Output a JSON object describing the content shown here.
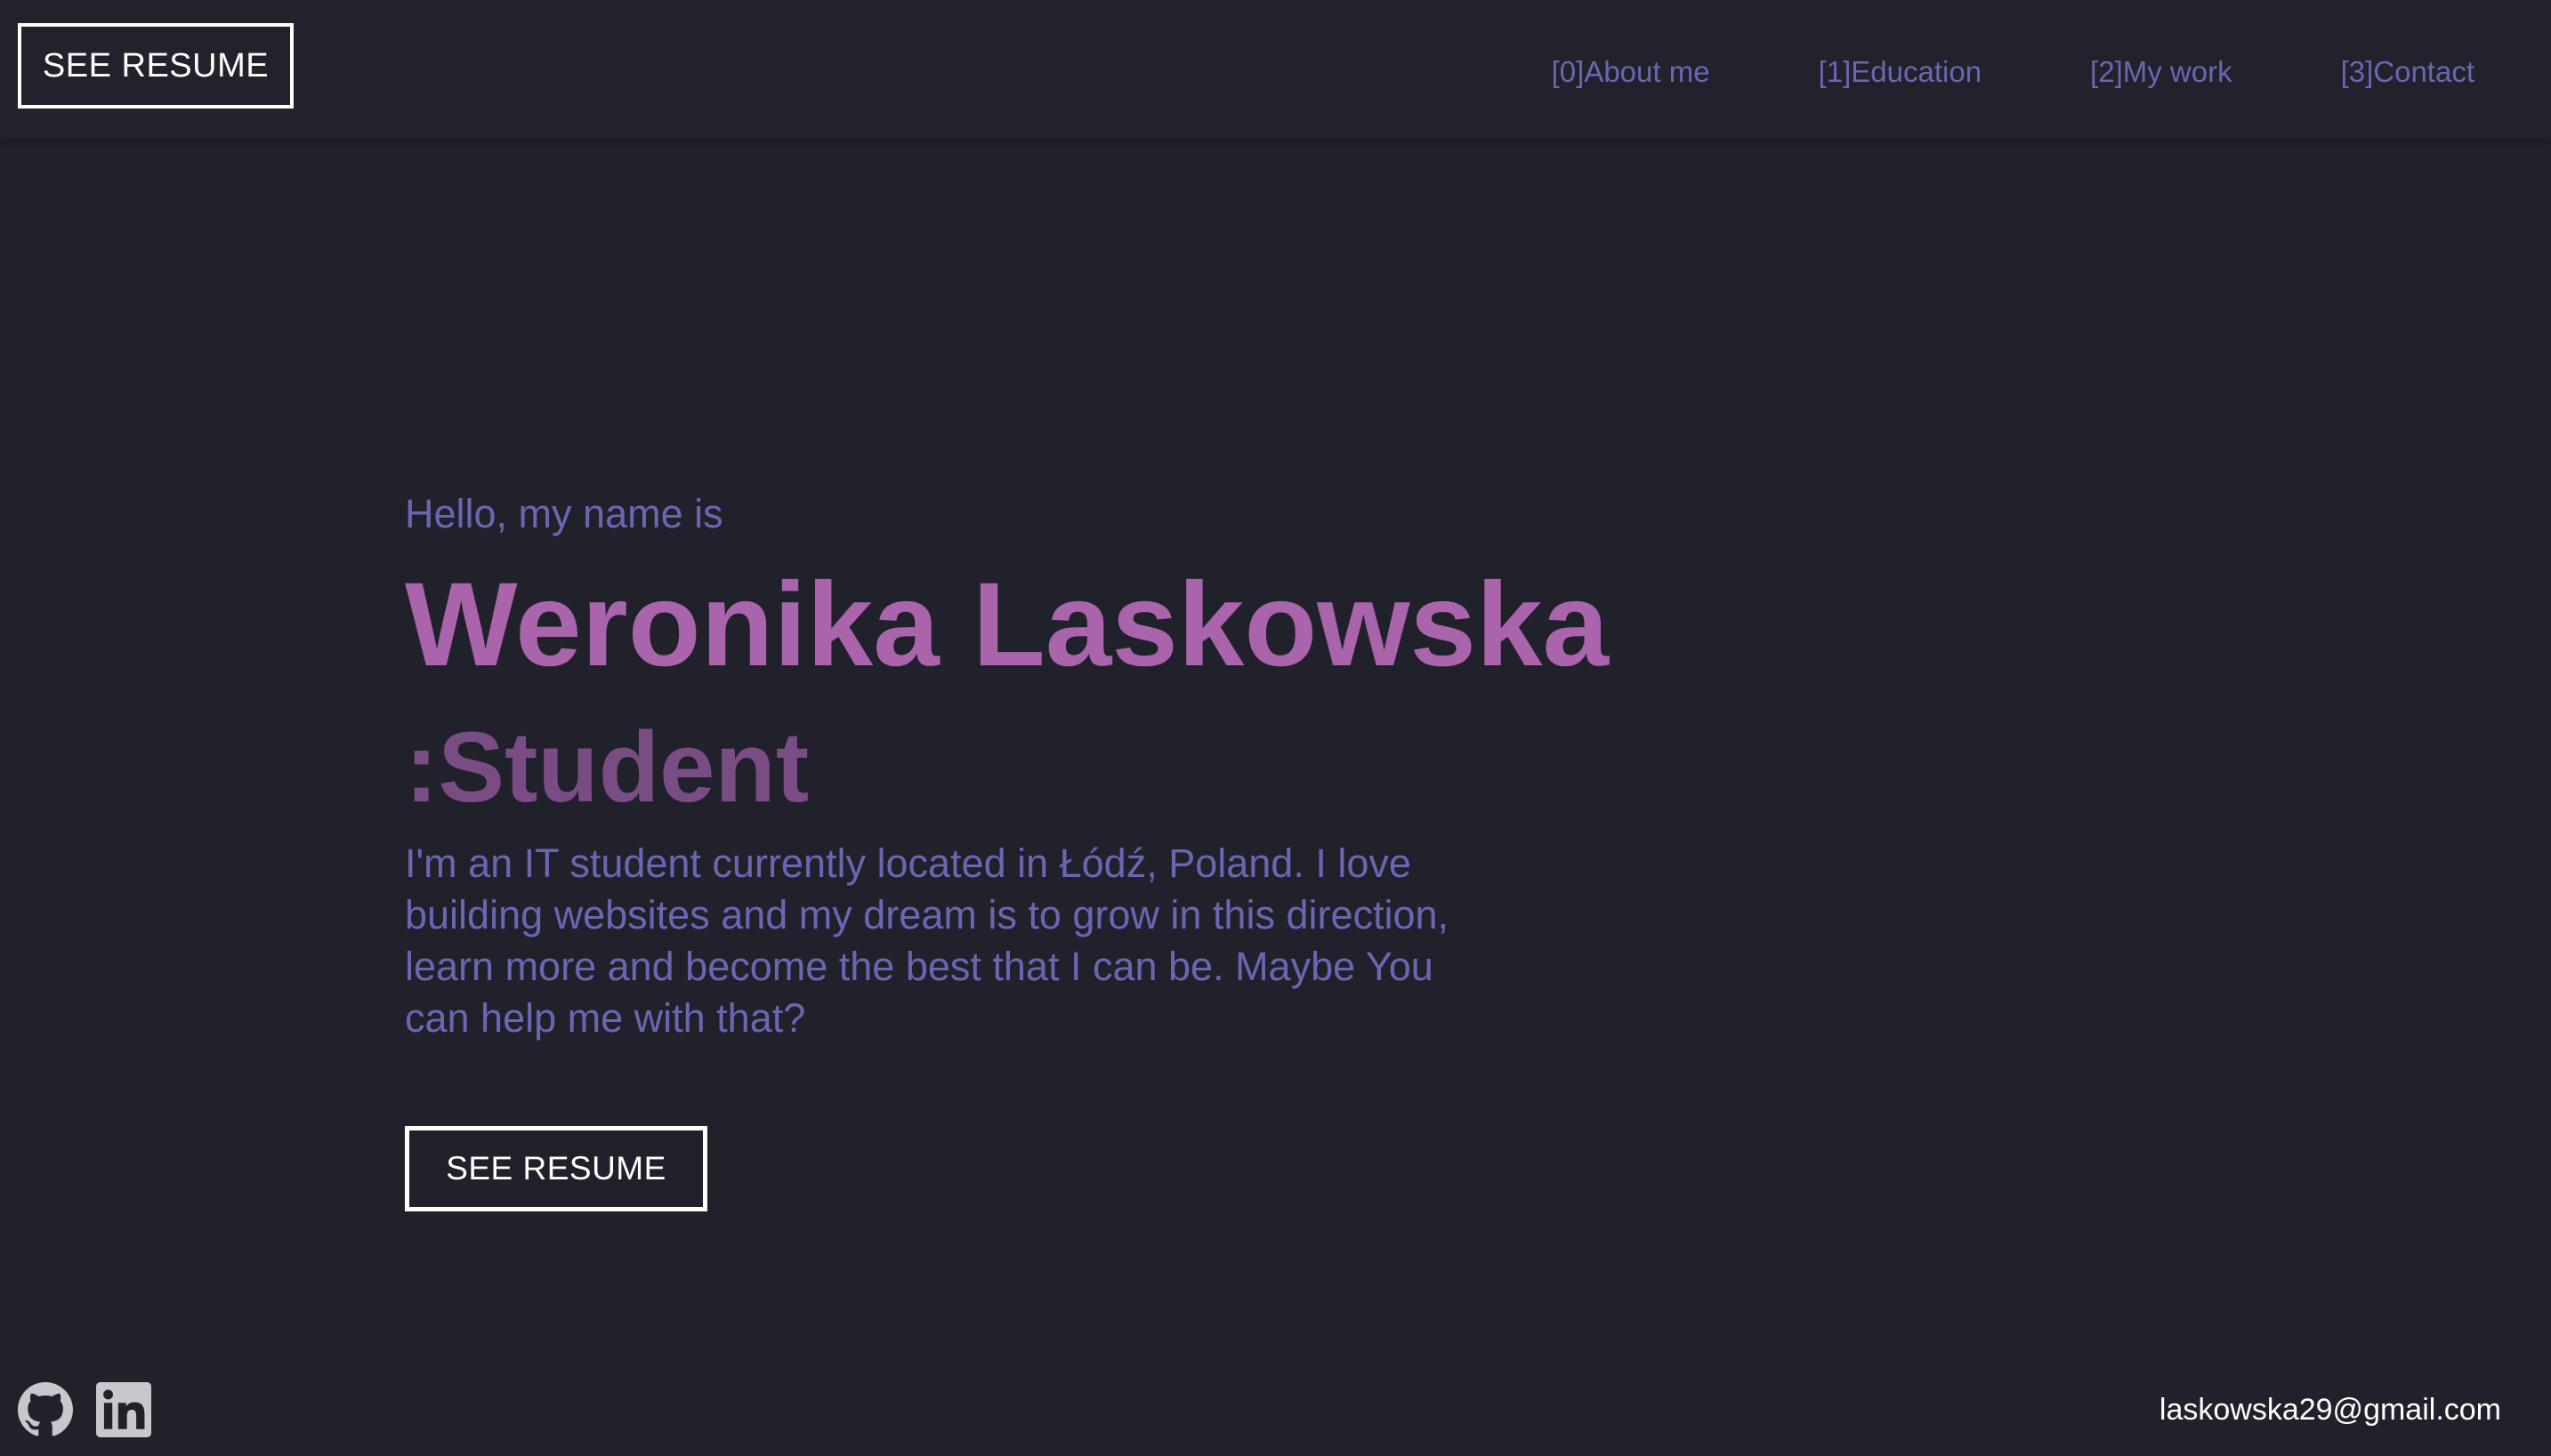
{
  "navbar": {
    "resume_button": "SEE RESUME",
    "links": [
      {
        "label": "[0]About me"
      },
      {
        "label": "[1]Education"
      },
      {
        "label": "[2]My work"
      },
      {
        "label": "[3]Contact"
      }
    ]
  },
  "hero": {
    "greeting": "Hello, my name is",
    "name": "Weronika Laskowska",
    "role": ":Student",
    "bio": "I'm an IT student currently located in Łódź, Poland. I love building websites and my dream is to grow in this direction, learn more and become the best that I can be. Maybe You can help me with that?",
    "resume_button": "SEE RESUME"
  },
  "footer": {
    "social_icons": [
      "github-icon",
      "linkedin-icon"
    ],
    "email": "laskowska29@gmail.com"
  },
  "colors": {
    "background": "#20212b",
    "accent_purple": "#6b66b2",
    "name_pink": "#aa64ac",
    "role_plum": "#7a4c84",
    "button_border": "#ffffff"
  }
}
